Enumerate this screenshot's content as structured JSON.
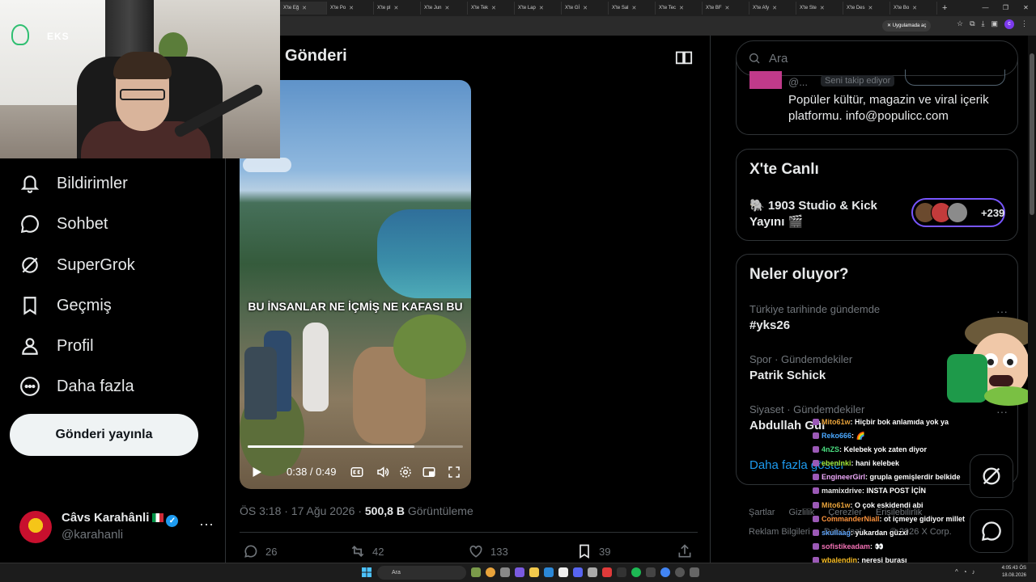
{
  "browser": {
    "tabs": [
      "X'te Eğ",
      "X'te Po",
      "X'te pl",
      "X'te Jun",
      "X'te Tek",
      "X'te Lap",
      "X'te Gİ",
      "X'te Sal",
      "X'te Tec",
      "X'te BF",
      "X'te Afy",
      "X'te Ste",
      "X'te Des",
      "X'te Bo"
    ],
    "app_pill": "Uygulamada aç"
  },
  "webcam": {
    "logo_text": "EKS"
  },
  "nav": {
    "items": [
      {
        "label": "Bildirimler",
        "icon": "bell-icon"
      },
      {
        "label": "Sohbet",
        "icon": "chat-bubble-icon"
      },
      {
        "label": "SuperGrok",
        "icon": "grok-icon"
      },
      {
        "label": "Geçmiş",
        "icon": "bookmark-icon"
      },
      {
        "label": "Profil",
        "icon": "person-icon"
      },
      {
        "label": "Daha fazla",
        "icon": "more-circle-icon"
      }
    ],
    "post_button": "Gönderi yayınla",
    "account": {
      "name": "Câvs Karahânli",
      "handle": "@karahanli"
    }
  },
  "post": {
    "page_title": "Gönderi",
    "video_caption": "BU İNSANLAR NE İÇMİŞ NE KAFASI BU",
    "time": "0:38 / 0:49",
    "progress": 0.775,
    "meta_time": "ÖS 3:18 · 17 Ağu 2026 · ",
    "views_count": "500,8 B",
    "views_label": " Görüntüleme",
    "replies": "26",
    "reposts": "42",
    "likes": "133",
    "bookmarks": "39"
  },
  "search": {
    "placeholder": "Ara"
  },
  "profile_card": {
    "handle": "@...",
    "badge": "Seni takip ediyor",
    "bio": "Popüler kültür, magazin ve viral içerik platformu. info@populicc.com"
  },
  "live": {
    "title": "X'te Canlı",
    "stream_name": "🐘 1903 Studio & Kick Yayını 🎬",
    "viewer_count": "+239"
  },
  "trends": {
    "title": "Neler oluyor?",
    "items": [
      {
        "meta": "Türkiye tarihinde gündemde",
        "title": "#yks26"
      },
      {
        "meta": "Spor · Gündemdekiler",
        "title": "Patrik Schick"
      },
      {
        "meta": "Siyaset · Gündemdekiler",
        "title": "Abdullah Gül"
      }
    ],
    "show_more": "Daha fazla göster"
  },
  "footer": {
    "line1": [
      "Şartlar",
      "Gizlilik",
      "Çerezler",
      "Erişilebilirlik"
    ],
    "line2": [
      "Reklam Bilgileri",
      "Daha fazla ...",
      "© 2026 X Corp."
    ]
  },
  "chat": [
    {
      "user": "Mito61w",
      "color": "#e8a33b",
      "text": ": Hiçbir bok anlamıda yok ya"
    },
    {
      "user": "Reko666",
      "color": "#4aa8ff",
      "text": ": 🌈"
    },
    {
      "user": "4nZS",
      "color": "#4ade80",
      "text": ": Kelebek yok zaten diyor"
    },
    {
      "user": "ebenlnki",
      "color": "#a3e635",
      "text": ": hani kelebek"
    },
    {
      "user": "EngineerGirl",
      "color": "#f0abfc",
      "text": ": grupla gemişlerdir belkide"
    },
    {
      "user": "mamixdrive",
      "color": "#e5e5e5",
      "text": ": INSTA POST İÇİN"
    },
    {
      "user": "Mito61w",
      "color": "#e8a33b",
      "text": ": O çok eskidendi abi"
    },
    {
      "user": "CommanderNiall",
      "color": "#fb923c",
      "text": ": ot içmeye gidiyor millet"
    },
    {
      "user": "skullaag",
      "color": "#60a5fa",
      "text": ": yukardan güzxl"
    },
    {
      "user": "sofistikeadam",
      "color": "#f472b6",
      "text": ": 👀"
    },
    {
      "user": "wbalendin",
      "color": "#fbbf24",
      "text": ": neresi burası"
    }
  ],
  "taskbar": {
    "search": "Ara",
    "time": "4:05:43 ÖS",
    "date": "18.08.2026"
  }
}
